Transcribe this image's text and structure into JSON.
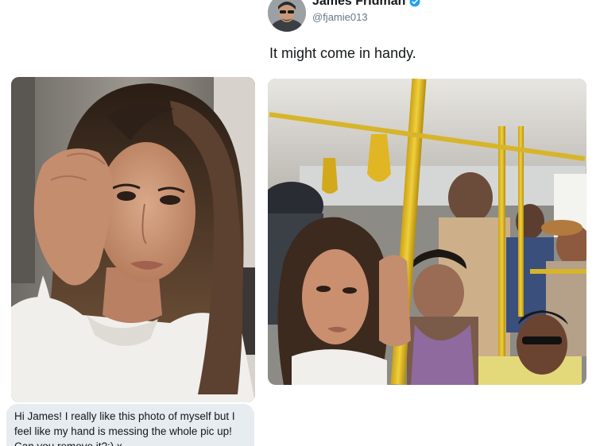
{
  "tweet": {
    "author_name": "James Fridman",
    "author_handle": "@fjamie013",
    "verified": true,
    "text": "It might come in handy.",
    "accent_color": "#1da1f2"
  },
  "message": {
    "text": "Hi James! I really like this photo of myself but I feel like my hand is messing the whole pic up! Can you remove it?:) x"
  },
  "images": {
    "selfie": "selfie-photo",
    "bus": "bus-photo"
  }
}
